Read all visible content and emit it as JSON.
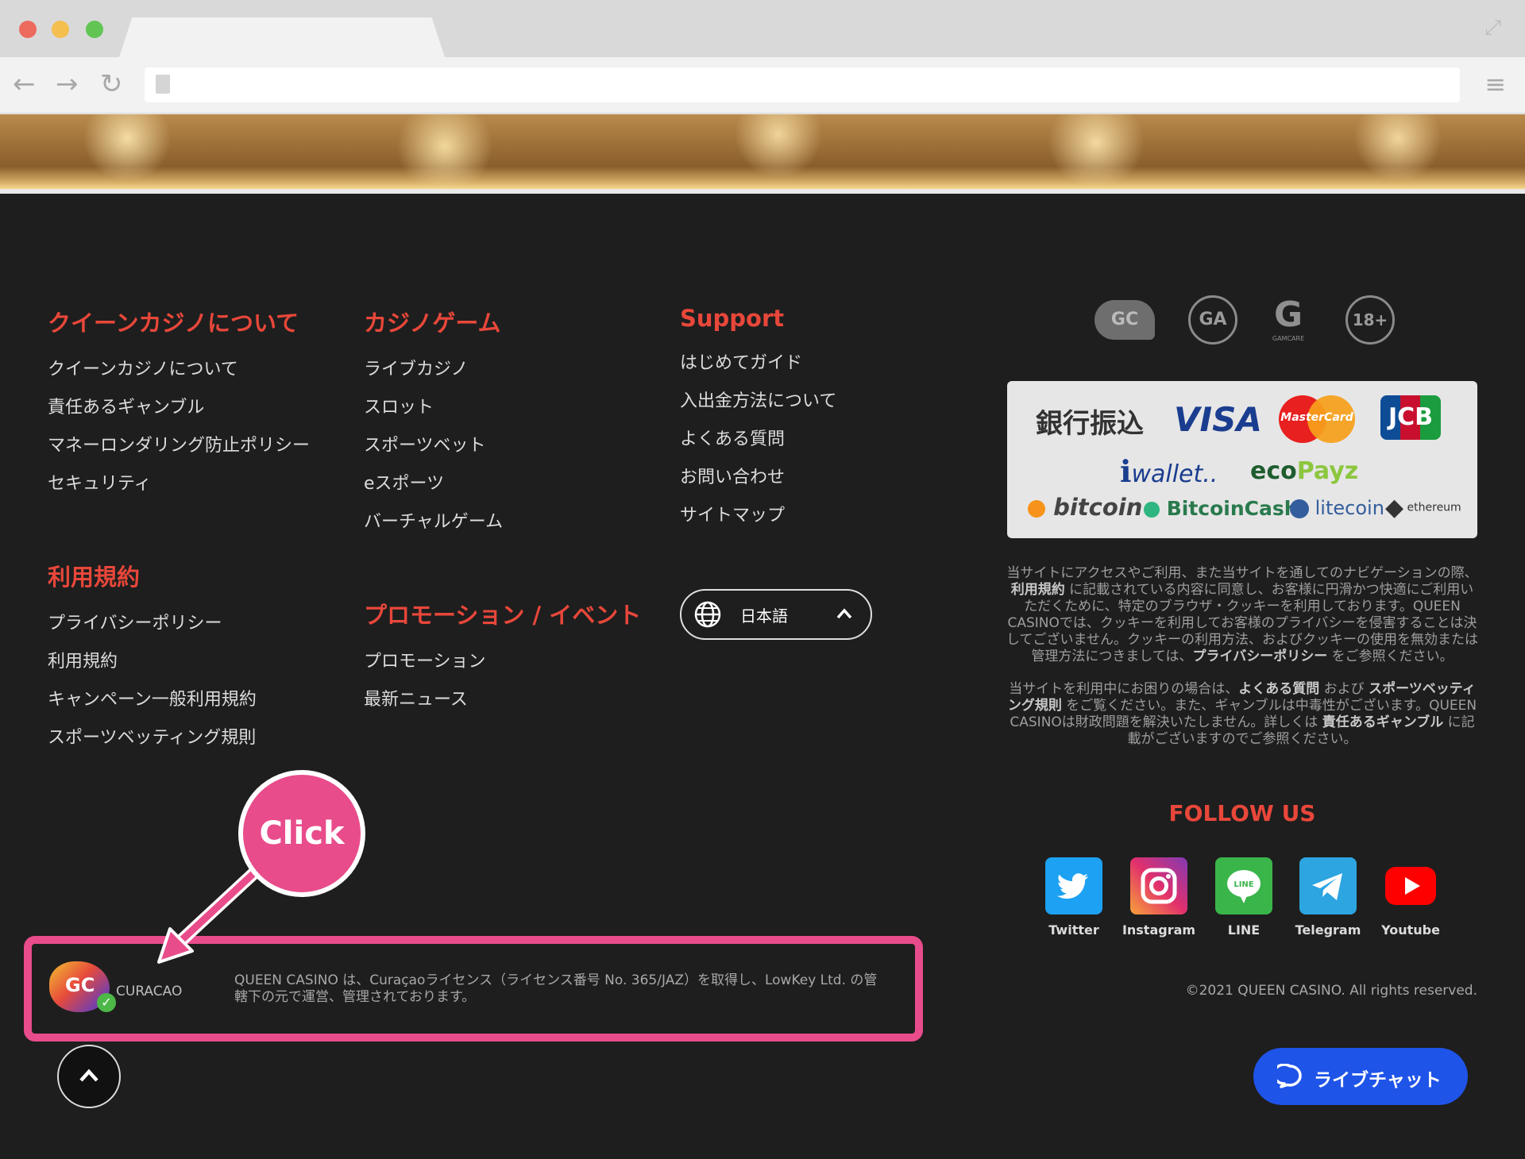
{
  "browser": {
    "traffic_lights": [
      "#ec6a5e",
      "#f4bf4f",
      "#61c554"
    ]
  },
  "columns": {
    "about": {
      "heading": "クイーンカジノについて",
      "links": [
        "クイーンカジノについて",
        "責任あるギャンブル",
        "マネーロンダリング防止ポリシー",
        "セキュリティ"
      ]
    },
    "terms": {
      "heading": "利用規約",
      "links": [
        "プライバシーポリシー",
        "利用規約",
        "キャンペーン一般利用規約",
        "スポーツベッティング規則"
      ]
    },
    "games": {
      "heading": "カジノゲーム",
      "links": [
        "ライブカジノ",
        "スロット",
        "スポーツベット",
        "eスポーツ",
        "バーチャルゲーム"
      ]
    },
    "promotions": {
      "heading": "プロモーション / イベント",
      "links": [
        "プロモーション",
        "最新ニュース"
      ]
    },
    "support": {
      "heading": "Support",
      "links": [
        "はじめてガイド",
        "入出金方法について",
        "よくある質問",
        "お問い合わせ",
        "サイトマップ"
      ]
    }
  },
  "language": {
    "label": "日本語"
  },
  "badges": [
    "GC",
    "GA",
    "GAMCARE",
    "18+"
  ],
  "payments": {
    "bank": "銀行振込",
    "visa": "VISA",
    "mastercard": "MasterCard",
    "jcb": "JCB",
    "iwallet": "wallet..",
    "ecopayz_a": "eco",
    "ecopayz_b": "Payz",
    "bitcoin": "bitcoin",
    "bitcoincash": "BitcoinCash",
    "litecoin": "litecoin",
    "ethereum": "ethereum"
  },
  "disclaimer": {
    "p1_a": "当サイトにアクセスやご利用、また当サイトを通してのナビゲーションの際、",
    "p1_b": "利用規約",
    "p1_c": "に記載されている内容に同意し、お客様に円滑かつ快適にご利用いただくために、特定のブラウザ・クッキーを利用しております。QUEEN CASINOでは、クッキーを利用してお客様のプライバシーを侵害することは決してございません。クッキーの利用方法、およびクッキーの使用を無効または管理方法につきましては、",
    "p1_d": "プライバシーポリシー",
    "p1_e": "をご参照ください。",
    "p2_a": "当サイトを利用中にお困りの場合は、",
    "p2_b": "よくある質問",
    "p2_c": "および",
    "p2_d": "スポーツベッティング規則",
    "p2_e": "をご覧ください。また、ギャンブルは中毒性がございます。QUEEN CASINOは財政問題を解決いたしません。詳しくは",
    "p2_f": "責任あるギャンブル",
    "p2_g": "に記載がございますのでご参照ください。"
  },
  "follow": {
    "title": "FOLLOW US",
    "items": [
      {
        "label": "Twitter",
        "icon": "twitter-icon",
        "color": "#1da1f2"
      },
      {
        "label": "Instagram",
        "icon": "instagram-icon",
        "color": "#d6297f"
      },
      {
        "label": "LINE",
        "icon": "line-icon",
        "color": "#3ab54a"
      },
      {
        "label": "Telegram",
        "icon": "telegram-icon",
        "color": "#2ca5e0"
      },
      {
        "label": "Youtube",
        "icon": "youtube-icon",
        "color": "#ff0000"
      }
    ]
  },
  "license": {
    "logo_gc": "GC",
    "logo_text": "CURACAO",
    "text": "QUEEN CASINO は、Curaçaoライセンス（ライセンス番号 No. 365/JAZ）を取得し、LowKey Ltd. の管轄下の元で運営、管理されております。"
  },
  "copyright": "©2021 QUEEN CASINO. All rights reserved.",
  "chat": {
    "label": "ライブチャット"
  },
  "annotation": {
    "label": "Click",
    "color": "#e84c8b"
  }
}
